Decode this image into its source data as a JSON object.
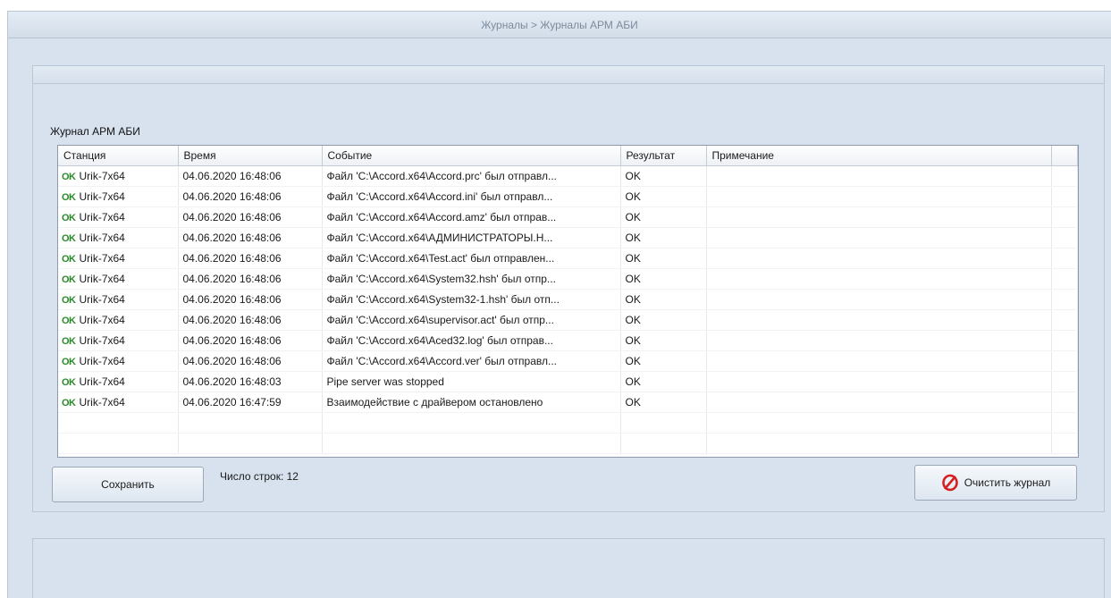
{
  "breadcrumb": "Журналы > Журналы АРМ АБИ",
  "log_title": "Журнал АРМ АБИ",
  "columns": [
    "Станция",
    "Время",
    "Событие",
    "Результат",
    "Примечание"
  ],
  "ok_badge": "OK",
  "rows": [
    {
      "station": "Urik-7x64",
      "time": "04.06.2020 16:48:06",
      "event": "Файл 'C:\\Accord.x64\\Accord.prc' был отправл...",
      "result": "OK",
      "note": ""
    },
    {
      "station": "Urik-7x64",
      "time": "04.06.2020 16:48:06",
      "event": "Файл 'C:\\Accord.x64\\Accord.ini' был отправл...",
      "result": "OK",
      "note": ""
    },
    {
      "station": "Urik-7x64",
      "time": "04.06.2020 16:48:06",
      "event": "Файл 'C:\\Accord.x64\\Accord.amz' был отправ...",
      "result": "OK",
      "note": ""
    },
    {
      "station": "Urik-7x64",
      "time": "04.06.2020 16:48:06",
      "event": "Файл 'C:\\Accord.x64\\АДМИНИСТРАТОРЫ.Н...",
      "result": "OK",
      "note": ""
    },
    {
      "station": "Urik-7x64",
      "time": "04.06.2020 16:48:06",
      "event": "Файл 'C:\\Accord.x64\\Test.act' был отправлен...",
      "result": "OK",
      "note": ""
    },
    {
      "station": "Urik-7x64",
      "time": "04.06.2020 16:48:06",
      "event": "Файл 'C:\\Accord.x64\\System32.hsh' был отпр...",
      "result": "OK",
      "note": ""
    },
    {
      "station": "Urik-7x64",
      "time": "04.06.2020 16:48:06",
      "event": "Файл 'C:\\Accord.x64\\System32-1.hsh' был отп...",
      "result": "OK",
      "note": ""
    },
    {
      "station": "Urik-7x64",
      "time": "04.06.2020 16:48:06",
      "event": "Файл 'C:\\Accord.x64\\supervisor.act' был отпр...",
      "result": "OK",
      "note": ""
    },
    {
      "station": "Urik-7x64",
      "time": "04.06.2020 16:48:06",
      "event": "Файл 'C:\\Accord.x64\\Aced32.log' был отправ...",
      "result": "OK",
      "note": ""
    },
    {
      "station": "Urik-7x64",
      "time": "04.06.2020 16:48:06",
      "event": "Файл 'C:\\Accord.x64\\Accord.ver' был отправл...",
      "result": "OK",
      "note": ""
    },
    {
      "station": "Urik-7x64",
      "time": "04.06.2020 16:48:03",
      "event": "Pipe server was stopped",
      "result": "OK",
      "note": ""
    },
    {
      "station": "Urik-7x64",
      "time": "04.06.2020 16:47:59",
      "event": "Взаимодействие с драйвером остановлено",
      "result": "OK",
      "note": ""
    }
  ],
  "buttons": {
    "save": "Сохранить",
    "clear": "Очистить журнал"
  },
  "row_count_label": "Число строк: 12",
  "colors": {
    "ok_green": "#2a8a2a",
    "clear_icon_red": "#d42020",
    "background": "#d8e2ee"
  },
  "icons": {
    "ok_badge": "ok-status-icon",
    "clear": "no-entry-icon"
  }
}
